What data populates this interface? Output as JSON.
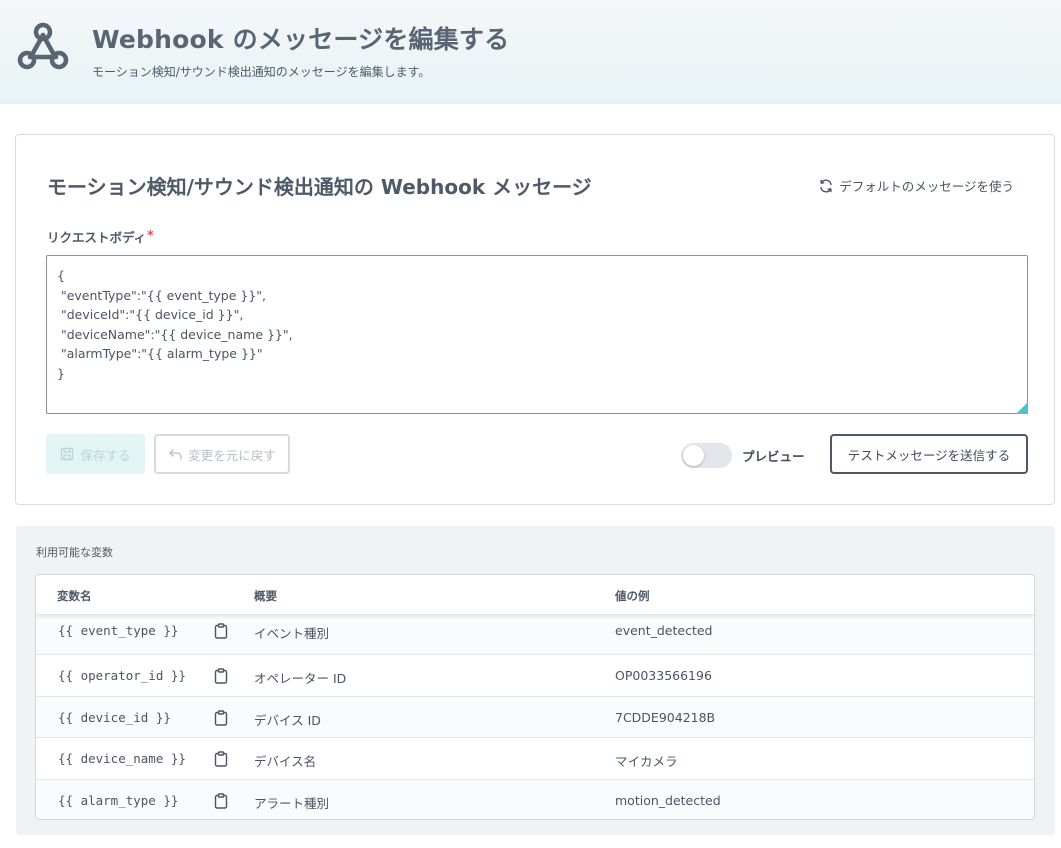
{
  "header": {
    "title": "Webhook のメッセージを編集する",
    "subtitle": "モーション検知/サウンド検出通知のメッセージを編集します。",
    "icon": "webhook-icon"
  },
  "card": {
    "title": "モーション検知/サウンド検出通知の Webhook メッセージ",
    "default_link": "デフォルトのメッセージを使う",
    "field_label": "リクエストボディ",
    "required_mark": "*",
    "body_value": "{\n \"eventType\":\"{{ event_type }}\",\n \"deviceId\":\"{{ device_id }}\",\n \"deviceName\":\"{{ device_name }}\",\n \"alarmType\":\"{{ alarm_type }}\"\n}",
    "save_label": "保存する",
    "revert_label": "変更を元に戻す",
    "preview_label": "プレビュー",
    "preview_on": false,
    "test_label": "テストメッセージを送信する"
  },
  "variables": {
    "title": "利用可能な変数",
    "headers": [
      "変数名",
      "概要",
      "値の例"
    ],
    "rows": [
      {
        "name": "{{ event_type }}",
        "desc": "イベント種別",
        "example": "event_detected"
      },
      {
        "name": "{{ operator_id }}",
        "desc": "オペレーター ID",
        "example": "OP0033566196"
      },
      {
        "name": "{{ device_id }}",
        "desc": "デバイス ID",
        "example": "7CDDE904218B"
      },
      {
        "name": "{{ device_name }}",
        "desc": "デバイス名",
        "example": "マイカメラ"
      },
      {
        "name": "{{ alarm_type }}",
        "desc": "アラート種別",
        "example": "motion_detected"
      }
    ]
  },
  "colors": {
    "accent": "#4ec1cf",
    "text": "#4a5463",
    "required": "#e24b4b"
  }
}
